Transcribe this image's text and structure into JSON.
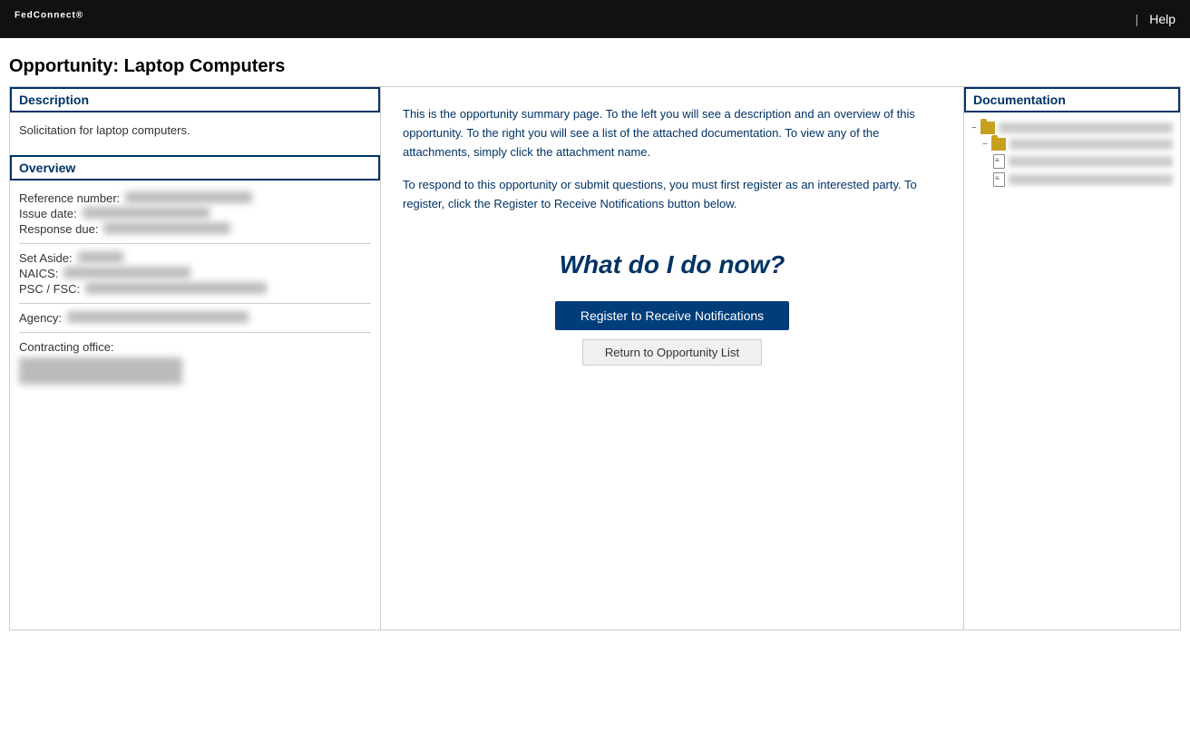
{
  "header": {
    "logo": "FedConnect",
    "logo_sup": "®",
    "divider": "|",
    "help_label": "Help"
  },
  "page_title": "Opportunity: Laptop Computers",
  "left_panel": {
    "description_header": "Description",
    "description_text": "Solicitation for laptop computers.",
    "overview_header": "Overview",
    "overview_fields": [
      {
        "label": "Reference number:"
      },
      {
        "label": "Issue date:"
      },
      {
        "label": "Response due:"
      },
      {
        "label": "Set Aside:"
      },
      {
        "label": "NAICS:"
      },
      {
        "label": "PSC / FSC:"
      },
      {
        "label": "Agency:"
      },
      {
        "label": "Contracting office:"
      }
    ]
  },
  "center_panel": {
    "summary_p1": "This is the opportunity summary page. To the left you will see a description and an overview of this opportunity. To the right you will see a list of the attached documentation. To view any of the attachments, simply click the attachment name.",
    "summary_p2": "To respond to this opportunity or submit questions, you must first register as an interested party. To register, click the Register to Receive Notifications button below.",
    "what_heading": "What do I do now?",
    "register_button": "Register to Receive Notifications",
    "return_button": "Return to Opportunity List"
  },
  "right_panel": {
    "documentation_header": "Documentation",
    "tree_items": [
      {
        "type": "folder",
        "level": 0,
        "toggle": "−"
      },
      {
        "type": "folder",
        "level": 1,
        "toggle": "−"
      },
      {
        "type": "doc",
        "level": 2
      },
      {
        "type": "doc",
        "level": 2
      }
    ]
  }
}
